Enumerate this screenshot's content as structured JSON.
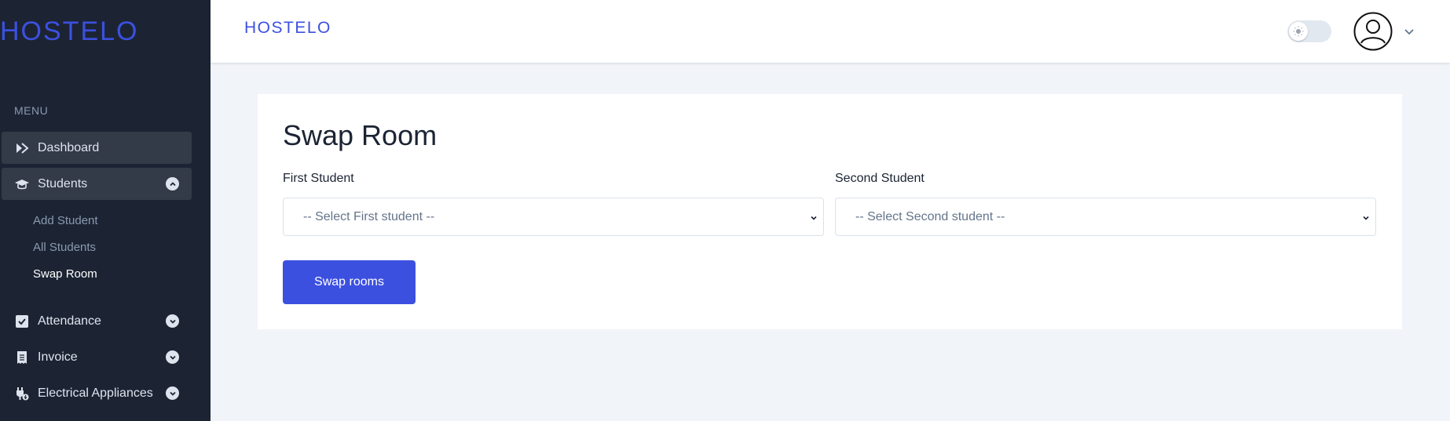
{
  "brand": {
    "name": "HOSTELO",
    "accent_color": "#3c50e0",
    "sidebar_bg": "#1c2434"
  },
  "sidebar": {
    "menu_heading": "MENU",
    "items": [
      {
        "label": "Dashboard",
        "icon": "dashboard-icon",
        "expandable": false,
        "active": true
      },
      {
        "label": "Students",
        "icon": "graduation-cap-icon",
        "expandable": true,
        "expanded": true,
        "active": true
      },
      {
        "label": "Attendance",
        "icon": "checkbox-icon",
        "expandable": true,
        "expanded": false
      },
      {
        "label": "Invoice",
        "icon": "receipt-icon",
        "expandable": true,
        "expanded": false
      },
      {
        "label": "Electrical Appliances",
        "icon": "plug-icon",
        "expandable": true,
        "expanded": false
      }
    ],
    "student_subitems": [
      {
        "label": "Add Student"
      },
      {
        "label": "All Students"
      },
      {
        "label": "Swap Room",
        "current": true
      }
    ]
  },
  "header": {
    "logo": "HOSTELO",
    "theme_toggle": "light-mode",
    "user_icon": "user-avatar-icon",
    "menu_icon": "chevron-down-icon"
  },
  "main": {
    "title": "Swap Room",
    "first_student": {
      "label": "First Student",
      "placeholder": "-- Select First student --"
    },
    "second_student": {
      "label": "Second Student",
      "placeholder": "-- Select Second student --"
    },
    "submit_label": "Swap rooms"
  }
}
